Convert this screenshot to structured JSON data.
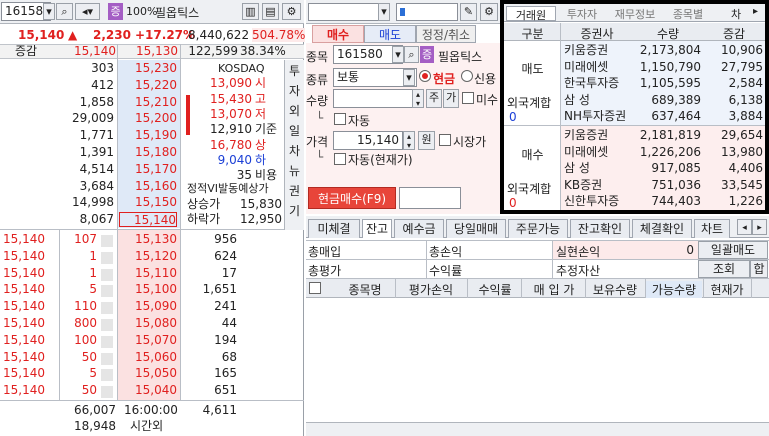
{
  "left": {
    "stock_code": "161580",
    "zoom": "100%",
    "stock_name": "필옵틱스",
    "price": "15,140",
    "change": "2,230",
    "change_pct": "+17.27%",
    "volume": "8,440,622",
    "volume_pct": "504.78%",
    "header": {
      "label": "증감",
      "ask_price": "15,140",
      "bid_price": "15,130",
      "total": "122,599",
      "ratio": "38.34%"
    },
    "asks": [
      {
        "qty": "303",
        "price": "15,230"
      },
      {
        "qty": "412",
        "price": "15,220"
      },
      {
        "qty": "1,858",
        "price": "15,210"
      },
      {
        "qty": "29,009",
        "price": "15,200"
      },
      {
        "qty": "1,771",
        "price": "15,190"
      },
      {
        "qty": "1,391",
        "price": "15,180"
      },
      {
        "qty": "4,514",
        "price": "15,170"
      },
      {
        "qty": "3,684",
        "price": "15,160"
      },
      {
        "qty": "14,998",
        "price": "15,150"
      },
      {
        "qty": "8,067",
        "price": "15,140"
      }
    ],
    "info": [
      {
        "label": "KOSDAQ",
        "value": ""
      },
      {
        "label": "13,090",
        "value": "시"
      },
      {
        "label": "15,430",
        "value": "고"
      },
      {
        "label": "13,070",
        "value": "저"
      },
      {
        "label": "12,910",
        "value": "기준"
      },
      {
        "label": "16,780",
        "value": "상"
      },
      {
        "label": "9,040",
        "value": "하"
      },
      {
        "label": "35",
        "value": "비용"
      }
    ],
    "vi": {
      "title": "정적VI발동예상가",
      "up_label": "상승가",
      "up_value": "15,830",
      "down_label": "하락가",
      "down_value": "12,950"
    },
    "side_tabs": [
      "투",
      "자",
      "외",
      "일",
      "차",
      "뉴",
      "권",
      "기"
    ],
    "ticks": [
      {
        "price": "15,140",
        "qty": "107"
      },
      {
        "price": "15,140",
        "qty": "1"
      },
      {
        "price": "15,140",
        "qty": "1"
      },
      {
        "price": "15,140",
        "qty": "5"
      },
      {
        "price": "15,140",
        "qty": "110"
      },
      {
        "price": "15,140",
        "qty": "800"
      },
      {
        "price": "15,140",
        "qty": "100"
      },
      {
        "price": "15,140",
        "qty": "50"
      },
      {
        "price": "15,140",
        "qty": "5"
      },
      {
        "price": "15,140",
        "qty": "50"
      }
    ],
    "bids": [
      {
        "price": "15,130",
        "qty": "956"
      },
      {
        "price": "15,120",
        "qty": "624"
      },
      {
        "price": "15,110",
        "qty": "17"
      },
      {
        "price": "15,100",
        "qty": "1,651"
      },
      {
        "price": "15,090",
        "qty": "241"
      },
      {
        "price": "15,080",
        "qty": "44"
      },
      {
        "price": "15,070",
        "qty": "194"
      },
      {
        "price": "15,060",
        "qty": "68"
      },
      {
        "price": "15,050",
        "qty": "165"
      },
      {
        "price": "15,040",
        "qty": "651"
      }
    ],
    "footer": {
      "ask_total": "66,007",
      "time": "16:00:00",
      "bid_total": "4,611",
      "after_total": "18,948",
      "after_label": "시간외"
    }
  },
  "order": {
    "tabs": [
      "매수",
      "매도",
      "정정/취소"
    ],
    "code_label": "종목",
    "code": "161580",
    "name": "필옵틱스",
    "type_label": "종류",
    "type": "보통",
    "radio_cash": "현금",
    "radio_credit": "신용",
    "qty_label": "수량",
    "btn_ju": "주",
    "btn_ga": "가",
    "chk_misu": "미수",
    "chk_auto": "자동",
    "price_label": "가격",
    "price": "15,140",
    "price_unit": "원",
    "chk_market": "시장가",
    "chk_auto_now": "자동(현재가)",
    "buy_button": "현금매수(F9)"
  },
  "broker": {
    "tabs": [
      "거래원",
      "투자자",
      "재무정보",
      "종목별",
      "차"
    ],
    "headers": [
      "구분",
      "증권사",
      "수량",
      "증감"
    ],
    "sell_label": "매도",
    "buy_label": "매수",
    "foreign_label": "외국계합",
    "foreign_sell_value": "0",
    "foreign_buy_value": "0",
    "sell_rows": [
      {
        "name": "키움증권",
        "qty": "2,173,804",
        "chg": "10,906"
      },
      {
        "name": "미래에셋",
        "qty": "1,150,790",
        "chg": "27,795"
      },
      {
        "name": "한국투자증",
        "qty": "1,105,595",
        "chg": "2,584"
      },
      {
        "name": "삼   성",
        "qty": "689,389",
        "chg": "6,138"
      },
      {
        "name": "NH투자증권",
        "qty": "637,464",
        "chg": "3,884"
      }
    ],
    "buy_rows": [
      {
        "name": "키움증권",
        "qty": "2,181,819",
        "chg": "29,654"
      },
      {
        "name": "미래에셋",
        "qty": "1,226,206",
        "chg": "13,980"
      },
      {
        "name": "삼   성",
        "qty": "917,085",
        "chg": "4,406"
      },
      {
        "name": "KB증권",
        "qty": "751,036",
        "chg": "33,545"
      },
      {
        "name": "신한투자증",
        "qty": "744,403",
        "chg": "1,226"
      }
    ]
  },
  "account": {
    "tabs": [
      "미체결",
      "잔고",
      "예수금",
      "당일매매",
      "주문가능",
      "잔고확인",
      "체결확인",
      "차트"
    ],
    "sum_buy_label": "총매입",
    "total_pl_label": "총손익",
    "realized_label": "실현손익",
    "realized_value": "0",
    "batch_sell": "일괄매도",
    "sum_eval_label": "총평가",
    "return_label": "수익률",
    "est_asset_label": "추정자산",
    "view_btn": "조회",
    "sum_btn": "합",
    "cols": [
      "종목명",
      "평가손익",
      "수익률",
      "매 입 가",
      "보유수량",
      "가능수량",
      "현재가"
    ]
  }
}
